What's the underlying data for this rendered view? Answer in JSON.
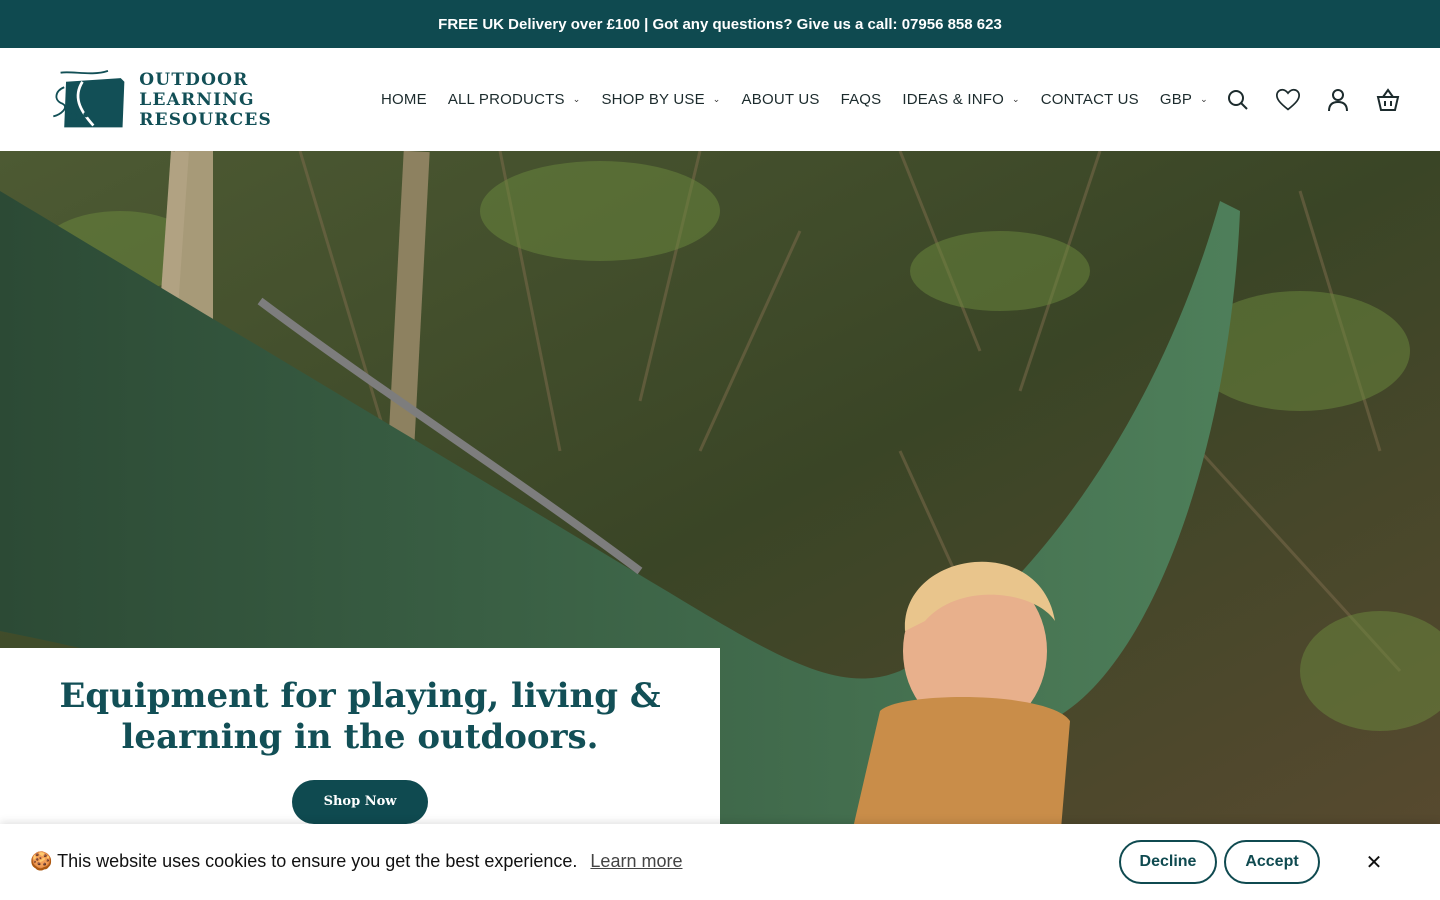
{
  "announcement": "FREE UK Delivery over £100 | Got any questions? Give us a call: 07956 858 623",
  "logo": {
    "line1": "OUTDOOR",
    "line2": "LEARNING",
    "line3": "RESOURCES"
  },
  "nav": {
    "home": "HOME",
    "all_products": "ALL PRODUCTS",
    "shop_by_use": "SHOP BY USE",
    "about": "ABOUT US",
    "faqs": "FAQS",
    "ideas": "IDEAS & INFO",
    "contact": "CONTACT US",
    "currency": "GBP"
  },
  "icons": {
    "search": "search-icon",
    "wishlist": "heart-icon",
    "account": "user-icon",
    "cart": "basket-icon"
  },
  "hero": {
    "title_line1": "Equipment for playing, living &",
    "title_line2": "learning in the outdoors.",
    "cta": "Shop Now"
  },
  "cookie": {
    "emoji": "🍪",
    "message": "This website uses cookies to ensure you get the best experience.",
    "learn_more": "Learn more",
    "decline": "Decline",
    "accept": "Accept",
    "close": "✕"
  },
  "colors": {
    "brand": "#0f4a50",
    "title": "#124f56"
  }
}
